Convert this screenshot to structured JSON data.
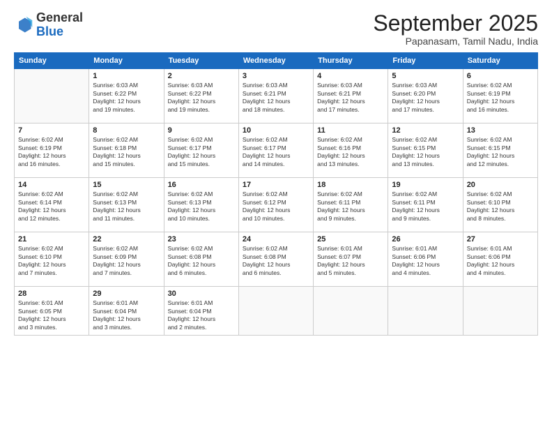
{
  "logo": {
    "general": "General",
    "blue": "Blue"
  },
  "header": {
    "month": "September 2025",
    "location": "Papanasam, Tamil Nadu, India"
  },
  "weekdays": [
    "Sunday",
    "Monday",
    "Tuesday",
    "Wednesday",
    "Thursday",
    "Friday",
    "Saturday"
  ],
  "weeks": [
    [
      {
        "day": "",
        "info": ""
      },
      {
        "day": "1",
        "info": "Sunrise: 6:03 AM\nSunset: 6:22 PM\nDaylight: 12 hours\nand 19 minutes."
      },
      {
        "day": "2",
        "info": "Sunrise: 6:03 AM\nSunset: 6:22 PM\nDaylight: 12 hours\nand 19 minutes."
      },
      {
        "day": "3",
        "info": "Sunrise: 6:03 AM\nSunset: 6:21 PM\nDaylight: 12 hours\nand 18 minutes."
      },
      {
        "day": "4",
        "info": "Sunrise: 6:03 AM\nSunset: 6:21 PM\nDaylight: 12 hours\nand 17 minutes."
      },
      {
        "day": "5",
        "info": "Sunrise: 6:03 AM\nSunset: 6:20 PM\nDaylight: 12 hours\nand 17 minutes."
      },
      {
        "day": "6",
        "info": "Sunrise: 6:02 AM\nSunset: 6:19 PM\nDaylight: 12 hours\nand 16 minutes."
      }
    ],
    [
      {
        "day": "7",
        "info": "Sunrise: 6:02 AM\nSunset: 6:19 PM\nDaylight: 12 hours\nand 16 minutes."
      },
      {
        "day": "8",
        "info": "Sunrise: 6:02 AM\nSunset: 6:18 PM\nDaylight: 12 hours\nand 15 minutes."
      },
      {
        "day": "9",
        "info": "Sunrise: 6:02 AM\nSunset: 6:17 PM\nDaylight: 12 hours\nand 15 minutes."
      },
      {
        "day": "10",
        "info": "Sunrise: 6:02 AM\nSunset: 6:17 PM\nDaylight: 12 hours\nand 14 minutes."
      },
      {
        "day": "11",
        "info": "Sunrise: 6:02 AM\nSunset: 6:16 PM\nDaylight: 12 hours\nand 13 minutes."
      },
      {
        "day": "12",
        "info": "Sunrise: 6:02 AM\nSunset: 6:15 PM\nDaylight: 12 hours\nand 13 minutes."
      },
      {
        "day": "13",
        "info": "Sunrise: 6:02 AM\nSunset: 6:15 PM\nDaylight: 12 hours\nand 12 minutes."
      }
    ],
    [
      {
        "day": "14",
        "info": "Sunrise: 6:02 AM\nSunset: 6:14 PM\nDaylight: 12 hours\nand 12 minutes."
      },
      {
        "day": "15",
        "info": "Sunrise: 6:02 AM\nSunset: 6:13 PM\nDaylight: 12 hours\nand 11 minutes."
      },
      {
        "day": "16",
        "info": "Sunrise: 6:02 AM\nSunset: 6:13 PM\nDaylight: 12 hours\nand 10 minutes."
      },
      {
        "day": "17",
        "info": "Sunrise: 6:02 AM\nSunset: 6:12 PM\nDaylight: 12 hours\nand 10 minutes."
      },
      {
        "day": "18",
        "info": "Sunrise: 6:02 AM\nSunset: 6:11 PM\nDaylight: 12 hours\nand 9 minutes."
      },
      {
        "day": "19",
        "info": "Sunrise: 6:02 AM\nSunset: 6:11 PM\nDaylight: 12 hours\nand 9 minutes."
      },
      {
        "day": "20",
        "info": "Sunrise: 6:02 AM\nSunset: 6:10 PM\nDaylight: 12 hours\nand 8 minutes."
      }
    ],
    [
      {
        "day": "21",
        "info": "Sunrise: 6:02 AM\nSunset: 6:10 PM\nDaylight: 12 hours\nand 7 minutes."
      },
      {
        "day": "22",
        "info": "Sunrise: 6:02 AM\nSunset: 6:09 PM\nDaylight: 12 hours\nand 7 minutes."
      },
      {
        "day": "23",
        "info": "Sunrise: 6:02 AM\nSunset: 6:08 PM\nDaylight: 12 hours\nand 6 minutes."
      },
      {
        "day": "24",
        "info": "Sunrise: 6:02 AM\nSunset: 6:08 PM\nDaylight: 12 hours\nand 6 minutes."
      },
      {
        "day": "25",
        "info": "Sunrise: 6:01 AM\nSunset: 6:07 PM\nDaylight: 12 hours\nand 5 minutes."
      },
      {
        "day": "26",
        "info": "Sunrise: 6:01 AM\nSunset: 6:06 PM\nDaylight: 12 hours\nand 4 minutes."
      },
      {
        "day": "27",
        "info": "Sunrise: 6:01 AM\nSunset: 6:06 PM\nDaylight: 12 hours\nand 4 minutes."
      }
    ],
    [
      {
        "day": "28",
        "info": "Sunrise: 6:01 AM\nSunset: 6:05 PM\nDaylight: 12 hours\nand 3 minutes."
      },
      {
        "day": "29",
        "info": "Sunrise: 6:01 AM\nSunset: 6:04 PM\nDaylight: 12 hours\nand 3 minutes."
      },
      {
        "day": "30",
        "info": "Sunrise: 6:01 AM\nSunset: 6:04 PM\nDaylight: 12 hours\nand 2 minutes."
      },
      {
        "day": "",
        "info": ""
      },
      {
        "day": "",
        "info": ""
      },
      {
        "day": "",
        "info": ""
      },
      {
        "day": "",
        "info": ""
      }
    ]
  ]
}
